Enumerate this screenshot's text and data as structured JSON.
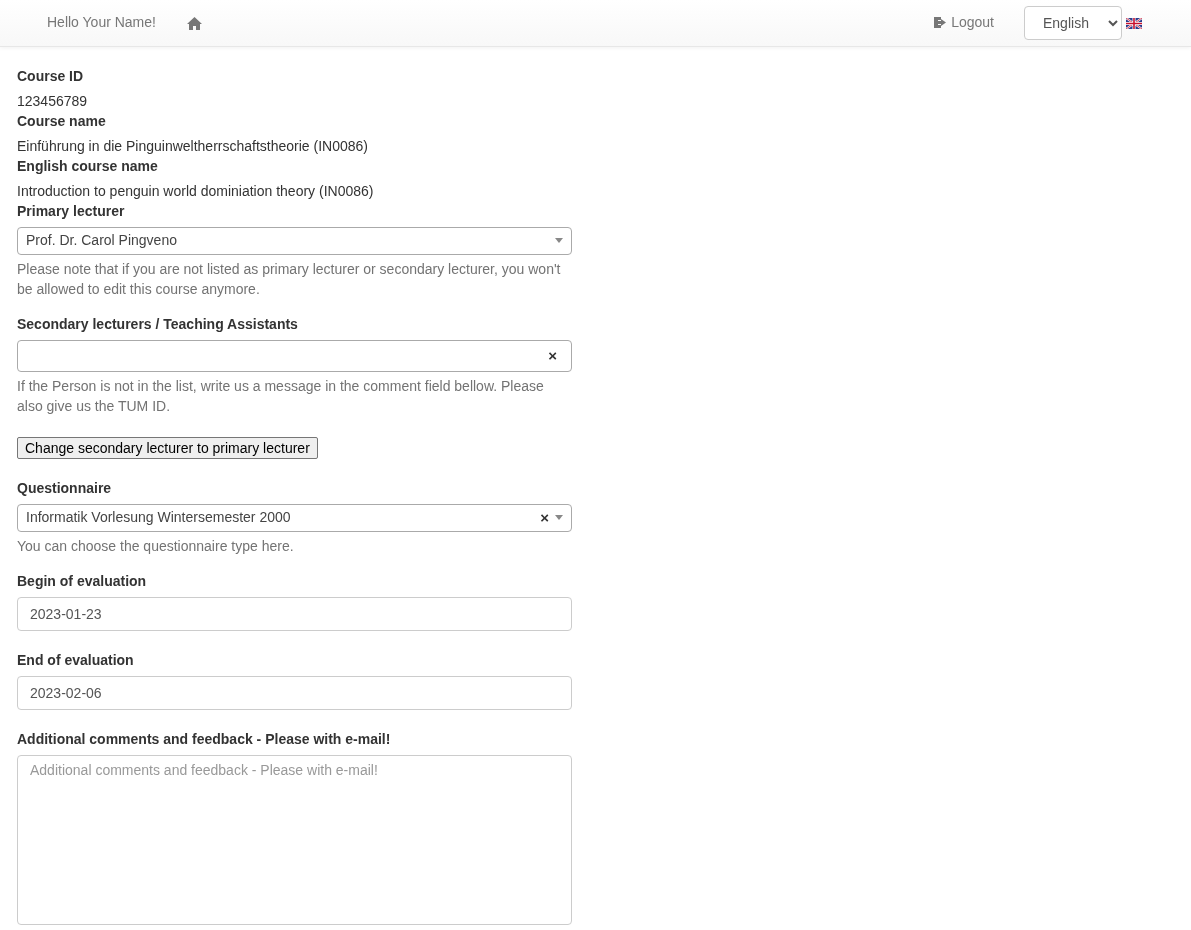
{
  "navbar": {
    "greeting": "Hello Your Name!",
    "logout": "Logout",
    "language": "English"
  },
  "info": [
    {
      "label": "Course ID",
      "value": "123456789"
    },
    {
      "label": "Course name",
      "value": "Einführung in die Pinguinweltherrschaftstheorie (IN0086)"
    },
    {
      "label": "English course name",
      "value": "Introduction to penguin world dominiation theory (IN0086)"
    }
  ],
  "fields": [
    {
      "kind": "select",
      "label": "Primary lecturer",
      "value": "Prof. Dr. Carol Pingveno",
      "help": "Please note that if you are not listed as primary lecturer or secondary lecturer, you won't be allowed to edit this course anymore."
    },
    {
      "kind": "multiselect",
      "label": "Secondary lecturers / Teaching Assistants",
      "clear": "×",
      "help": "If the Person is not in the list, write us a message in the comment field bellow. Please also give us the TUM ID."
    },
    {
      "kind": "button",
      "label": "Change secondary lecturer to primary lecturer"
    },
    {
      "kind": "select",
      "label": "Questionnaire",
      "value": "Informatik Vorlesung Wintersemester 2000",
      "clear": "×",
      "help": "You can choose the questionnaire type here."
    },
    {
      "kind": "input",
      "label": "Begin of evaluation",
      "value": "2023-01-23"
    },
    {
      "kind": "input",
      "label": "End of evaluation",
      "value": "2023-02-06"
    },
    {
      "kind": "textarea",
      "label": "Additional comments and feedback - Please with e-mail!",
      "placeholder": "Additional comments and feedback - Please with e-mail!"
    }
  ]
}
